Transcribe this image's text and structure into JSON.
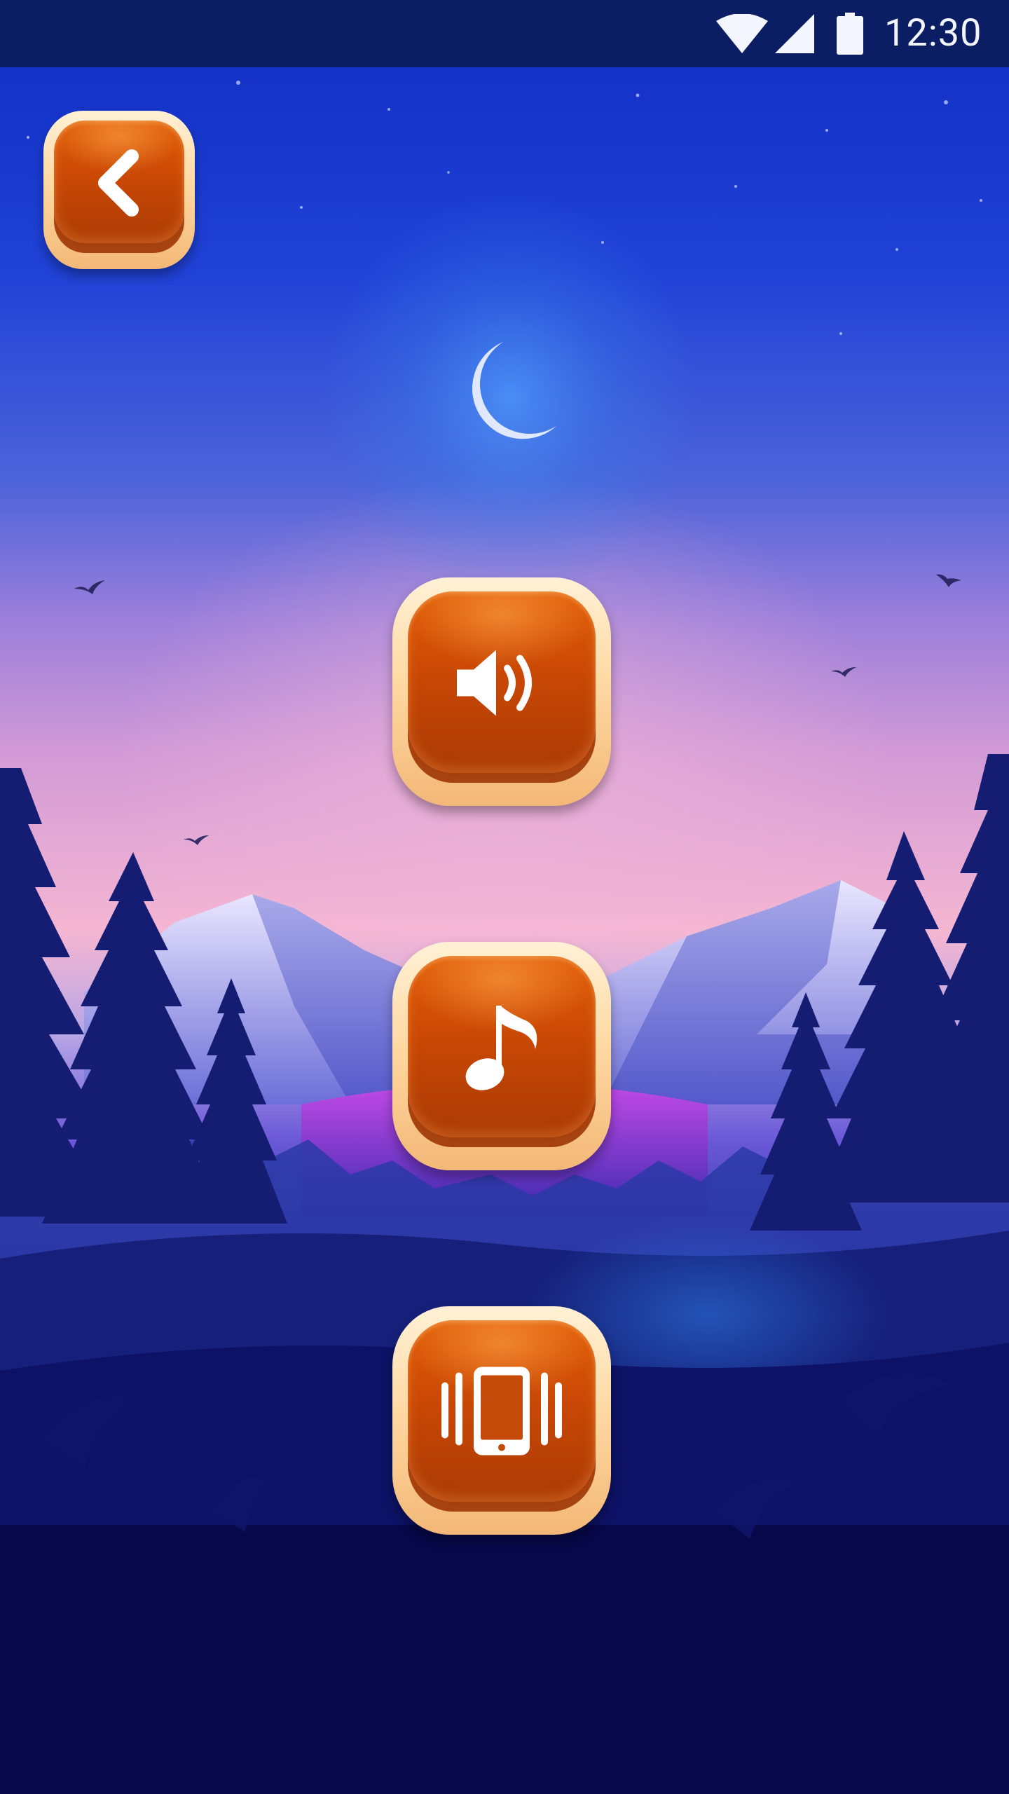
{
  "status_bar": {
    "time": "12:30",
    "icons": [
      "wifi-icon",
      "cellular-signal-icon",
      "battery-icon"
    ]
  },
  "buttons": {
    "back": {
      "icon": "chevron-left-icon"
    },
    "sound": {
      "icon": "speaker-volume-icon"
    },
    "music": {
      "icon": "music-note-icon"
    },
    "vibration": {
      "icon": "phone-vibrate-icon"
    }
  },
  "colors": {
    "status_bar_bg": "#0b1d63",
    "sky_top": "#1432c8",
    "sky_glow": "#f2b3d2",
    "ground": "#07084a",
    "button_face": "#c84705",
    "button_frame": "#ffd9a3"
  }
}
